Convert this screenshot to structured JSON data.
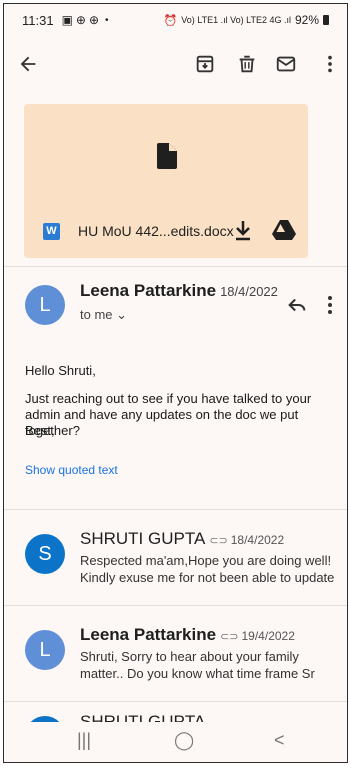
{
  "status": {
    "time": "11:31",
    "left_icons": [
      "gallery-icon",
      "game-icon",
      "game-icon-2"
    ],
    "dot": "•",
    "right_text": "Vo) LTE1 .ıl Vo) LTE2 4G .ıl",
    "battery": "92%"
  },
  "toolbar": {
    "back": "back-arrow-icon",
    "archive": "archive-icon",
    "delete": "delete-icon",
    "mail": "mail-icon",
    "more": "more-vert-icon"
  },
  "attachment": {
    "type_badge": "W",
    "file_name": "HU MoU 442...edits.docx",
    "download": "download-icon",
    "drive": "drive-icon"
  },
  "message": {
    "avatar_letter": "L",
    "sender": "Leena Pattarkine",
    "date": "18/4/2022",
    "to": "to me ⌄",
    "greeting": "Hello Shruti,",
    "body": "Just reaching out to see if you have talked to your admin and have any updates on the doc we put together?",
    "signoff": "Best,",
    "show_quoted": "Show quoted text"
  },
  "thread": [
    {
      "avatar_letter": "S",
      "sender": "SHRUTI GUPTA",
      "date": "18/4/2022",
      "snippet_line1": "Respected ma'am,Hope you are doing well!",
      "snippet_line2": "Kindly exuse me for not been able to update"
    },
    {
      "avatar_letter": "L",
      "sender": "Leena Pattarkine",
      "date": "19/4/2022",
      "snippet_line1": "Shruti, Sorry to hear about your family",
      "snippet_line2": "matter.. Do you know what time frame Sr"
    },
    {
      "avatar_letter": "S",
      "sender": "SHRUTI GUPTA",
      "date": ""
    }
  ],
  "nav": {
    "recents": "|||",
    "home": "◯",
    "back": "<"
  }
}
